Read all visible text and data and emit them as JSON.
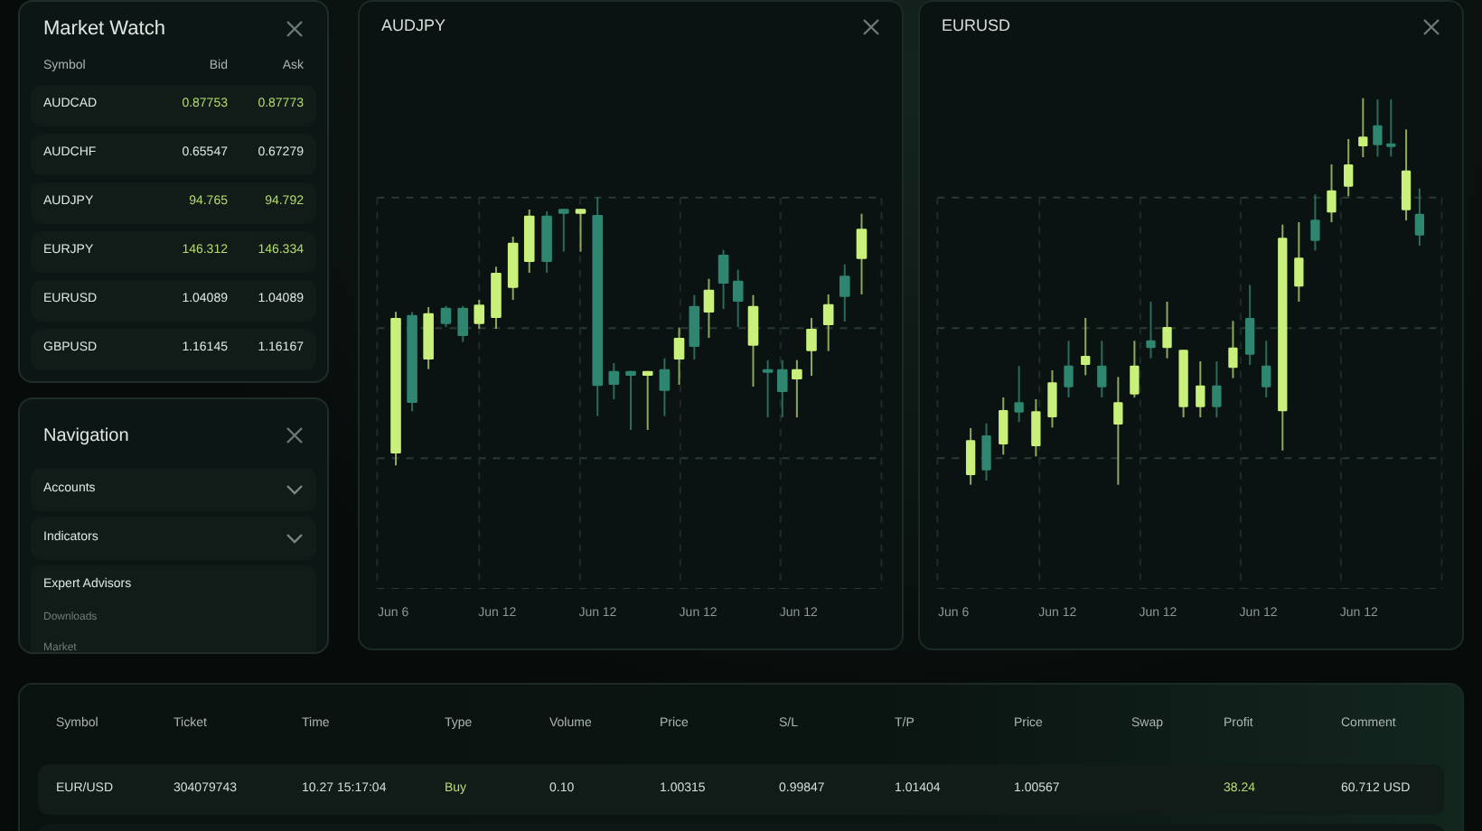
{
  "market_watch": {
    "title": "Market Watch",
    "columns": [
      "Symbol",
      "Bid",
      "Ask"
    ],
    "rows": [
      {
        "symbol": "AUDCAD",
        "bid": "0.87753",
        "ask": "0.87773",
        "rising": true
      },
      {
        "symbol": "AUDCHF",
        "bid": "0.65547",
        "ask": "0.67279",
        "rising": false
      },
      {
        "symbol": "AUDJPY",
        "bid": "94.765",
        "ask": "94.792",
        "rising": true
      },
      {
        "symbol": "EURJPY",
        "bid": "146.312",
        "ask": "146.334",
        "rising": true
      },
      {
        "symbol": "EURUSD",
        "bid": "1.04089",
        "ask": "1.04089",
        "rising": false
      },
      {
        "symbol": "GBPUSD",
        "bid": "1.16145",
        "ask": "1.16167",
        "rising": false
      }
    ]
  },
  "navigation": {
    "title": "Navigation",
    "items": [
      {
        "label": "Accounts",
        "expanded": false
      },
      {
        "label": "Indicators",
        "expanded": false
      },
      {
        "label": "Expert Advisors",
        "expanded": true,
        "children": [
          "Downloads",
          "Market"
        ]
      }
    ]
  },
  "charts": [
    {
      "symbol": "AUDJPY",
      "x_labels": [
        "Jun 6",
        "Jun 12",
        "Jun 12",
        "Jun 12",
        "Jun 12"
      ]
    },
    {
      "symbol": "EURUSD",
      "x_labels": [
        "Jun 6",
        "Jun 12",
        "Jun 12",
        "Jun 12",
        "Jun 12"
      ]
    }
  ],
  "trades": {
    "columns": [
      "Symbol",
      "Ticket",
      "Time",
      "Type",
      "Volume",
      "Price",
      "S/L",
      "T/P",
      "Price",
      "Swap",
      "Profit",
      "Comment"
    ],
    "rows": [
      {
        "cells": [
          {
            "text": "EUR/USD",
            "highlighted": false
          },
          {
            "text": "304079743",
            "highlighted": false
          },
          {
            "text": "10.27 15:17:04",
            "highlighted": false
          },
          {
            "text": "Buy",
            "highlighted": true
          },
          {
            "text": "0.10",
            "highlighted": false
          },
          {
            "text": "1.00315",
            "highlighted": false
          },
          {
            "text": "0.99847",
            "highlighted": false
          },
          {
            "text": "1.01404",
            "highlighted": false
          },
          {
            "text": "1.00567",
            "highlighted": false
          },
          null,
          {
            "text": "38.24",
            "highlighted": true
          },
          {
            "text": "60.712 USD",
            "highlighted": false
          }
        ]
      }
    ]
  }
}
